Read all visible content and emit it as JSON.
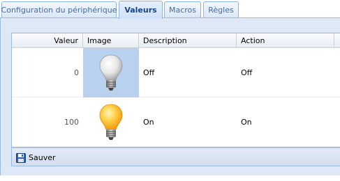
{
  "tabs": [
    {
      "label": "Configuration du périphérique",
      "active": false
    },
    {
      "label": "Valeurs",
      "active": true
    },
    {
      "label": "Macros",
      "active": false
    },
    {
      "label": "Règles",
      "active": false
    }
  ],
  "grid": {
    "columns": [
      "Valeur",
      "Image",
      "Description",
      "Action"
    ],
    "rows": [
      {
        "value": "0",
        "image": "bulb-off-icon",
        "description": "Off",
        "action": "Off",
        "selected": true
      },
      {
        "value": "100",
        "image": "bulb-on-icon",
        "description": "On",
        "action": "On",
        "selected": false
      }
    ]
  },
  "toolbar": {
    "save_label": "Sauver",
    "save_icon": "floppy-disk-icon"
  },
  "colors": {
    "accent": "#15428b",
    "panel": "#dfe8f6",
    "border": "#99bbe8",
    "selection": "#b9d1ef"
  }
}
